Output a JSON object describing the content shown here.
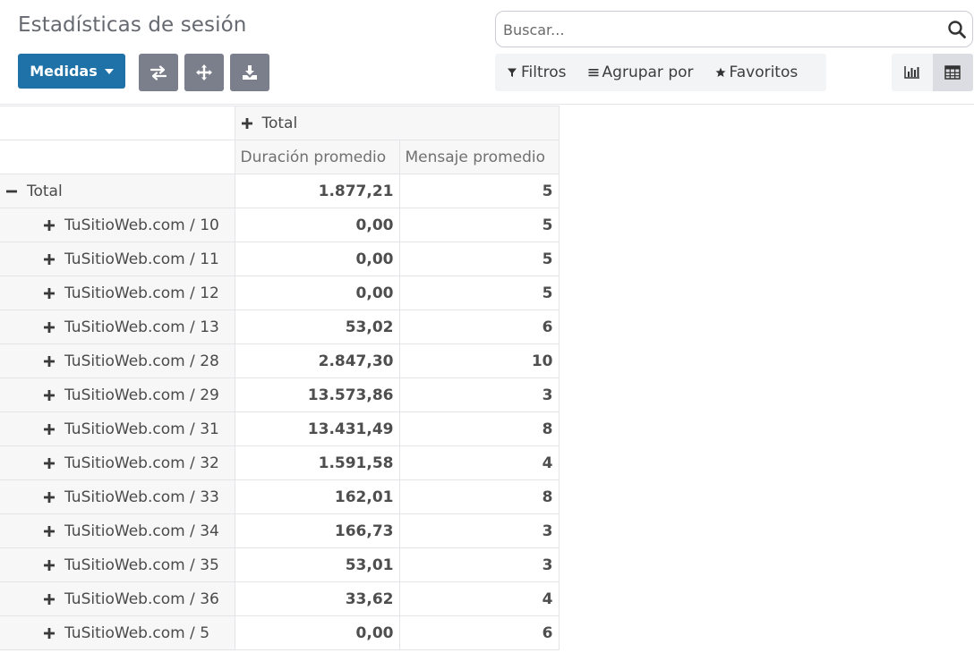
{
  "page": {
    "title": "Estadísticas de sesión"
  },
  "search": {
    "placeholder": "Buscar..."
  },
  "toolbar": {
    "measures_label": "Medidas",
    "flip_icon": "exchange-icon",
    "expand_icon": "arrows-icon",
    "download_icon": "download-icon"
  },
  "filters": {
    "filters_label": "Filtros",
    "group_by_label": "Agrupar por",
    "favorites_label": "Favoritos"
  },
  "view_switch": {
    "graph": "bar-chart-icon",
    "pivot": "table-icon",
    "active": "pivot"
  },
  "pivot": {
    "col_header": "Total",
    "measures": [
      "Duración promedio",
      "Mensaje promedio"
    ],
    "total": {
      "label": "Total",
      "duration": "1.877,21",
      "messages": "5"
    },
    "rows": [
      {
        "label": "TuSitioWeb.com / 10",
        "duration": "0,00",
        "messages": "5"
      },
      {
        "label": "TuSitioWeb.com / 11",
        "duration": "0,00",
        "messages": "5"
      },
      {
        "label": "TuSitioWeb.com / 12",
        "duration": "0,00",
        "messages": "5"
      },
      {
        "label": "TuSitioWeb.com / 13",
        "duration": "53,02",
        "messages": "6"
      },
      {
        "label": "TuSitioWeb.com / 28",
        "duration": "2.847,30",
        "messages": "10"
      },
      {
        "label": "TuSitioWeb.com / 29",
        "duration": "13.573,86",
        "messages": "3"
      },
      {
        "label": "TuSitioWeb.com / 31",
        "duration": "13.431,49",
        "messages": "8"
      },
      {
        "label": "TuSitioWeb.com / 32",
        "duration": "1.591,58",
        "messages": "4"
      },
      {
        "label": "TuSitioWeb.com / 33",
        "duration": "162,01",
        "messages": "8"
      },
      {
        "label": "TuSitioWeb.com / 34",
        "duration": "166,73",
        "messages": "3"
      },
      {
        "label": "TuSitioWeb.com / 35",
        "duration": "53,01",
        "messages": "3"
      },
      {
        "label": "TuSitioWeb.com / 36",
        "duration": "33,62",
        "messages": "4"
      },
      {
        "label": "TuSitioWeb.com / 5",
        "duration": "0,00",
        "messages": "6"
      }
    ]
  },
  "colors": {
    "primary": "#1f72a8",
    "secondary_btn": "#7b7f8b",
    "header_bg": "#f7f7f8"
  }
}
